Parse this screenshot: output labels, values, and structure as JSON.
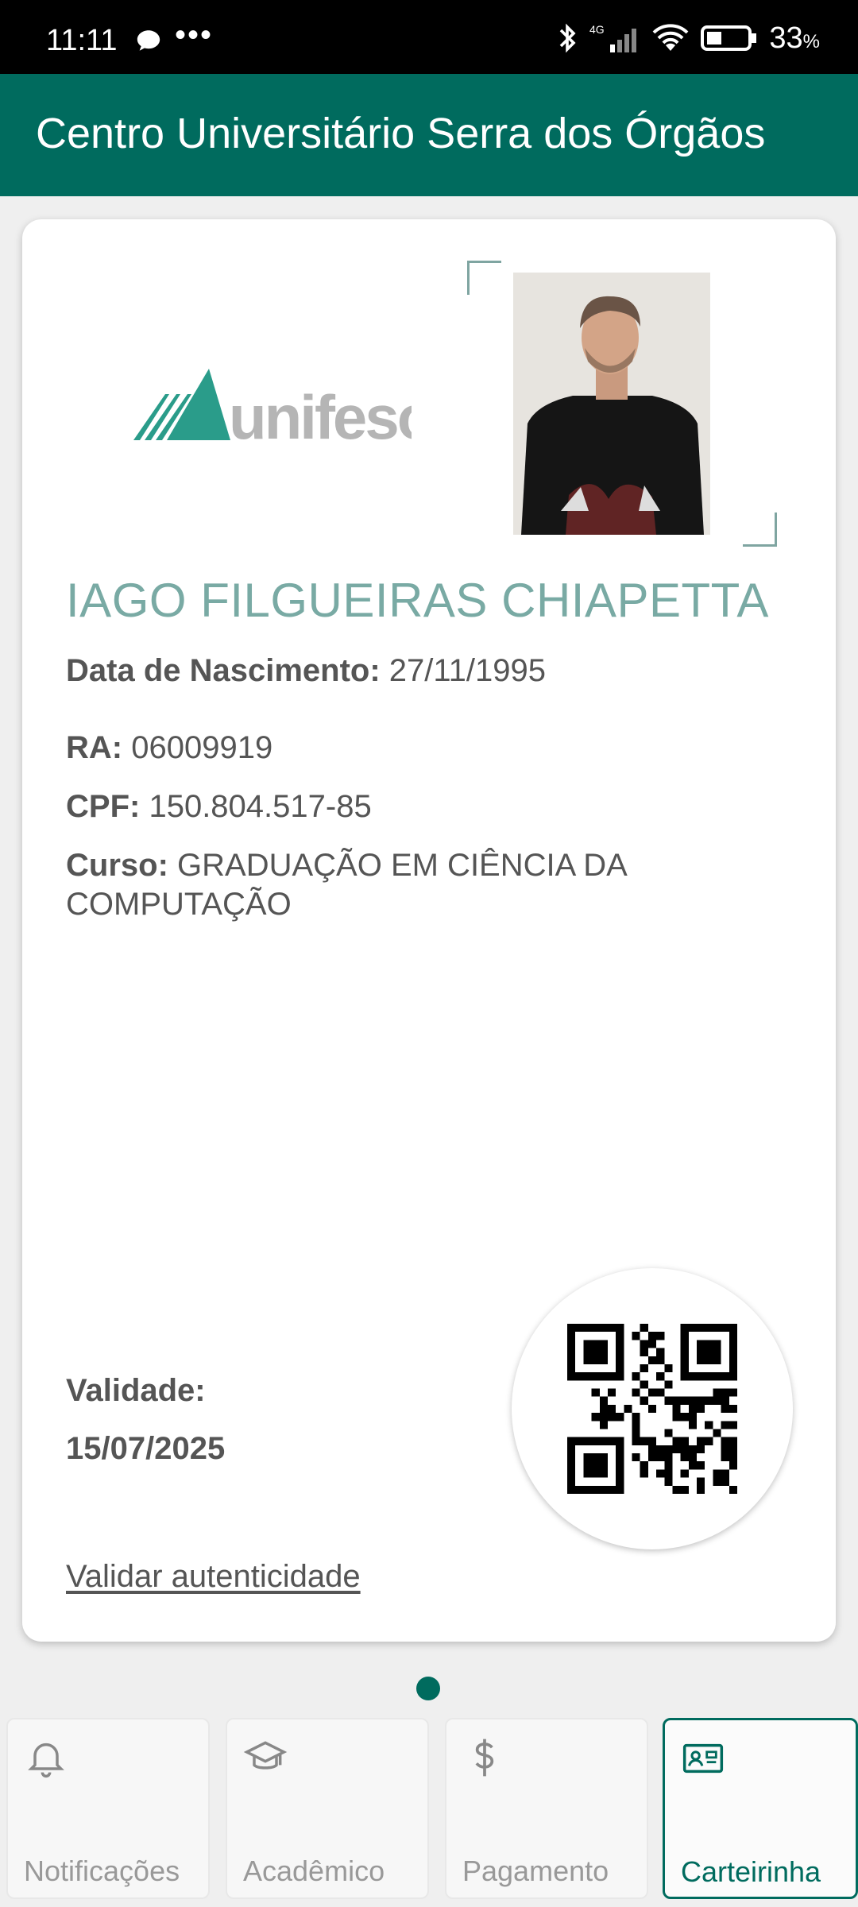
{
  "status_bar": {
    "time": "11:11",
    "dots": "•••",
    "network": "4G",
    "battery": "33",
    "battery_unit": "%"
  },
  "app_bar": {
    "title": "Centro Universitário Serra dos Órgãos"
  },
  "card": {
    "logo_text": "unifeso",
    "student_name": "IAGO FILGUEIRAS CHIAPETTA",
    "birth_label": "Data de Nascimento:",
    "birth_value": "27/11/1995",
    "ra_label": "RA:",
    "ra_value": "06009919",
    "cpf_label": "CPF:",
    "cpf_value": "150.804.517-85",
    "course_label": "Curso:",
    "course_value": "GRADUAÇÃO EM CIÊNCIA DA COMPUTAÇÃO",
    "validity_label": "Validade:",
    "validity_value": "15/07/2025",
    "validate_link": "Validar autenticidade"
  },
  "bottom_nav": {
    "tabs": [
      {
        "label": "Notificações",
        "icon": "bell-icon"
      },
      {
        "label": "Acadêmico",
        "icon": "graduation-cap-icon"
      },
      {
        "label": "Pagamento",
        "icon": "dollar-icon"
      },
      {
        "label": "Carteirinha",
        "icon": "id-card-icon"
      }
    ],
    "active": "Carteirinha"
  },
  "colors": {
    "primary": "#006b5e",
    "name_color": "#79aaa4",
    "text": "#555555",
    "background": "#efefef"
  }
}
